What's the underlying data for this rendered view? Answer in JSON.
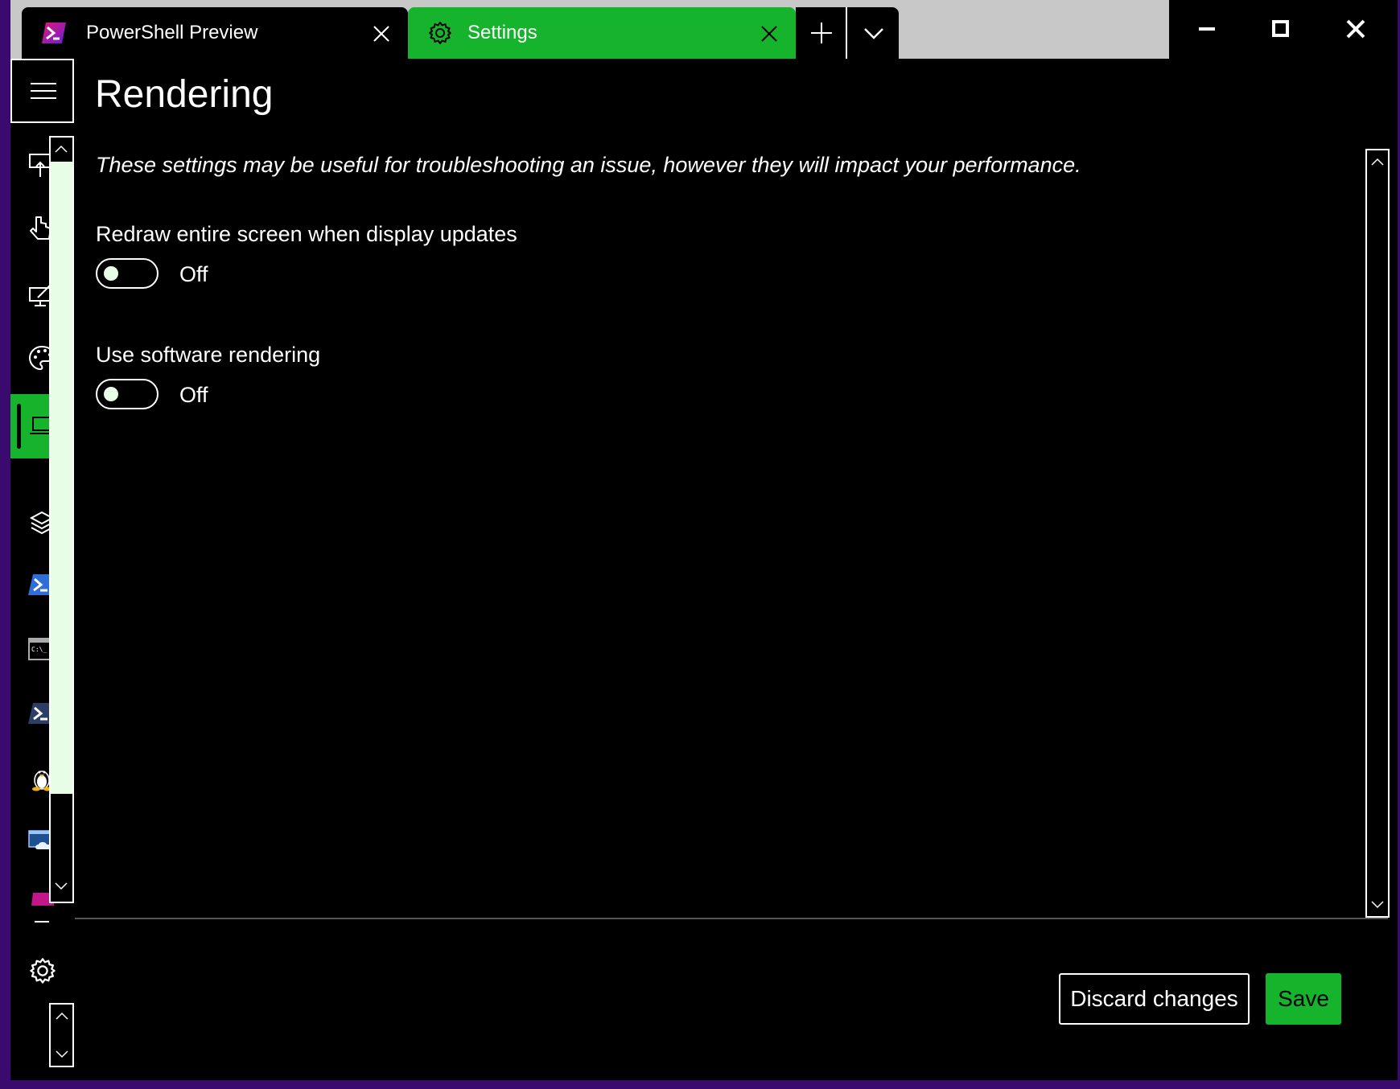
{
  "window": {
    "tabs": [
      {
        "title": "PowerShell Preview",
        "icon": "powershell-preview-icon",
        "active": false
      },
      {
        "title": "Settings",
        "icon": "gear-icon",
        "active": true
      }
    ],
    "new_tab_icon": "plus-icon",
    "dropdown_icon": "chevron-down-icon",
    "controls": [
      "minimize-icon",
      "maximize-icon",
      "close-icon"
    ]
  },
  "nav": {
    "menu_icon": "hamburger-menu-icon",
    "items": [
      {
        "icon": "startup-icon"
      },
      {
        "icon": "interaction-icon"
      },
      {
        "icon": "appearance-icon"
      },
      {
        "icon": "color-schemes-icon"
      },
      {
        "icon": "rendering-icon",
        "selected": true
      },
      {
        "icon": "defaults-icon"
      },
      {
        "icon": "windows-powershell-icon"
      },
      {
        "icon": "command-prompt-icon"
      },
      {
        "icon": "powershell-icon"
      },
      {
        "icon": "linux-icon"
      },
      {
        "icon": "azure-cloud-shell-icon"
      },
      {
        "icon": "powershell-preview-icon"
      }
    ],
    "settings_icon": "gear-icon"
  },
  "page": {
    "title": "Rendering",
    "description": "These settings may be useful for troubleshooting an issue, however they will impact your performance.",
    "settings": [
      {
        "label": "Redraw entire screen when display updates",
        "state": "Off"
      },
      {
        "label": "Use software rendering",
        "state": "Off"
      }
    ]
  },
  "footer": {
    "discard_label": "Discard changes",
    "save_label": "Save"
  },
  "colors": {
    "accent": "#16b32c",
    "background": "#000000",
    "scroll_thumb": "#e8fde6",
    "window_border": "#3a0a6e"
  }
}
